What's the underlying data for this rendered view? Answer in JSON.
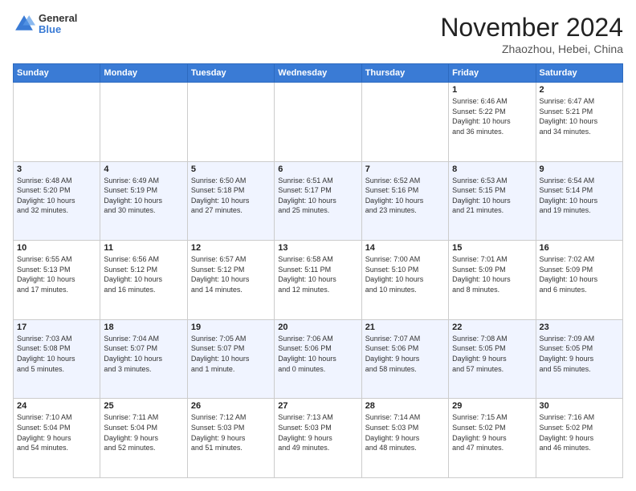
{
  "header": {
    "logo": {
      "general": "General",
      "blue": "Blue"
    },
    "title": "November 2024",
    "location": "Zhaozhou, Hebei, China"
  },
  "calendar": {
    "days_of_week": [
      "Sunday",
      "Monday",
      "Tuesday",
      "Wednesday",
      "Thursday",
      "Friday",
      "Saturday"
    ],
    "weeks": [
      [
        {
          "day": "",
          "info": ""
        },
        {
          "day": "",
          "info": ""
        },
        {
          "day": "",
          "info": ""
        },
        {
          "day": "",
          "info": ""
        },
        {
          "day": "",
          "info": ""
        },
        {
          "day": "1",
          "info": "Sunrise: 6:46 AM\nSunset: 5:22 PM\nDaylight: 10 hours\nand 36 minutes."
        },
        {
          "day": "2",
          "info": "Sunrise: 6:47 AM\nSunset: 5:21 PM\nDaylight: 10 hours\nand 34 minutes."
        }
      ],
      [
        {
          "day": "3",
          "info": "Sunrise: 6:48 AM\nSunset: 5:20 PM\nDaylight: 10 hours\nand 32 minutes."
        },
        {
          "day": "4",
          "info": "Sunrise: 6:49 AM\nSunset: 5:19 PM\nDaylight: 10 hours\nand 30 minutes."
        },
        {
          "day": "5",
          "info": "Sunrise: 6:50 AM\nSunset: 5:18 PM\nDaylight: 10 hours\nand 27 minutes."
        },
        {
          "day": "6",
          "info": "Sunrise: 6:51 AM\nSunset: 5:17 PM\nDaylight: 10 hours\nand 25 minutes."
        },
        {
          "day": "7",
          "info": "Sunrise: 6:52 AM\nSunset: 5:16 PM\nDaylight: 10 hours\nand 23 minutes."
        },
        {
          "day": "8",
          "info": "Sunrise: 6:53 AM\nSunset: 5:15 PM\nDaylight: 10 hours\nand 21 minutes."
        },
        {
          "day": "9",
          "info": "Sunrise: 6:54 AM\nSunset: 5:14 PM\nDaylight: 10 hours\nand 19 minutes."
        }
      ],
      [
        {
          "day": "10",
          "info": "Sunrise: 6:55 AM\nSunset: 5:13 PM\nDaylight: 10 hours\nand 17 minutes."
        },
        {
          "day": "11",
          "info": "Sunrise: 6:56 AM\nSunset: 5:12 PM\nDaylight: 10 hours\nand 16 minutes."
        },
        {
          "day": "12",
          "info": "Sunrise: 6:57 AM\nSunset: 5:12 PM\nDaylight: 10 hours\nand 14 minutes."
        },
        {
          "day": "13",
          "info": "Sunrise: 6:58 AM\nSunset: 5:11 PM\nDaylight: 10 hours\nand 12 minutes."
        },
        {
          "day": "14",
          "info": "Sunrise: 7:00 AM\nSunset: 5:10 PM\nDaylight: 10 hours\nand 10 minutes."
        },
        {
          "day": "15",
          "info": "Sunrise: 7:01 AM\nSunset: 5:09 PM\nDaylight: 10 hours\nand 8 minutes."
        },
        {
          "day": "16",
          "info": "Sunrise: 7:02 AM\nSunset: 5:09 PM\nDaylight: 10 hours\nand 6 minutes."
        }
      ],
      [
        {
          "day": "17",
          "info": "Sunrise: 7:03 AM\nSunset: 5:08 PM\nDaylight: 10 hours\nand 5 minutes."
        },
        {
          "day": "18",
          "info": "Sunrise: 7:04 AM\nSunset: 5:07 PM\nDaylight: 10 hours\nand 3 minutes."
        },
        {
          "day": "19",
          "info": "Sunrise: 7:05 AM\nSunset: 5:07 PM\nDaylight: 10 hours\nand 1 minute."
        },
        {
          "day": "20",
          "info": "Sunrise: 7:06 AM\nSunset: 5:06 PM\nDaylight: 10 hours\nand 0 minutes."
        },
        {
          "day": "21",
          "info": "Sunrise: 7:07 AM\nSunset: 5:06 PM\nDaylight: 9 hours\nand 58 minutes."
        },
        {
          "day": "22",
          "info": "Sunrise: 7:08 AM\nSunset: 5:05 PM\nDaylight: 9 hours\nand 57 minutes."
        },
        {
          "day": "23",
          "info": "Sunrise: 7:09 AM\nSunset: 5:05 PM\nDaylight: 9 hours\nand 55 minutes."
        }
      ],
      [
        {
          "day": "24",
          "info": "Sunrise: 7:10 AM\nSunset: 5:04 PM\nDaylight: 9 hours\nand 54 minutes."
        },
        {
          "day": "25",
          "info": "Sunrise: 7:11 AM\nSunset: 5:04 PM\nDaylight: 9 hours\nand 52 minutes."
        },
        {
          "day": "26",
          "info": "Sunrise: 7:12 AM\nSunset: 5:03 PM\nDaylight: 9 hours\nand 51 minutes."
        },
        {
          "day": "27",
          "info": "Sunrise: 7:13 AM\nSunset: 5:03 PM\nDaylight: 9 hours\nand 49 minutes."
        },
        {
          "day": "28",
          "info": "Sunrise: 7:14 AM\nSunset: 5:03 PM\nDaylight: 9 hours\nand 48 minutes."
        },
        {
          "day": "29",
          "info": "Sunrise: 7:15 AM\nSunset: 5:02 PM\nDaylight: 9 hours\nand 47 minutes."
        },
        {
          "day": "30",
          "info": "Sunrise: 7:16 AM\nSunset: 5:02 PM\nDaylight: 9 hours\nand 46 minutes."
        }
      ]
    ]
  }
}
